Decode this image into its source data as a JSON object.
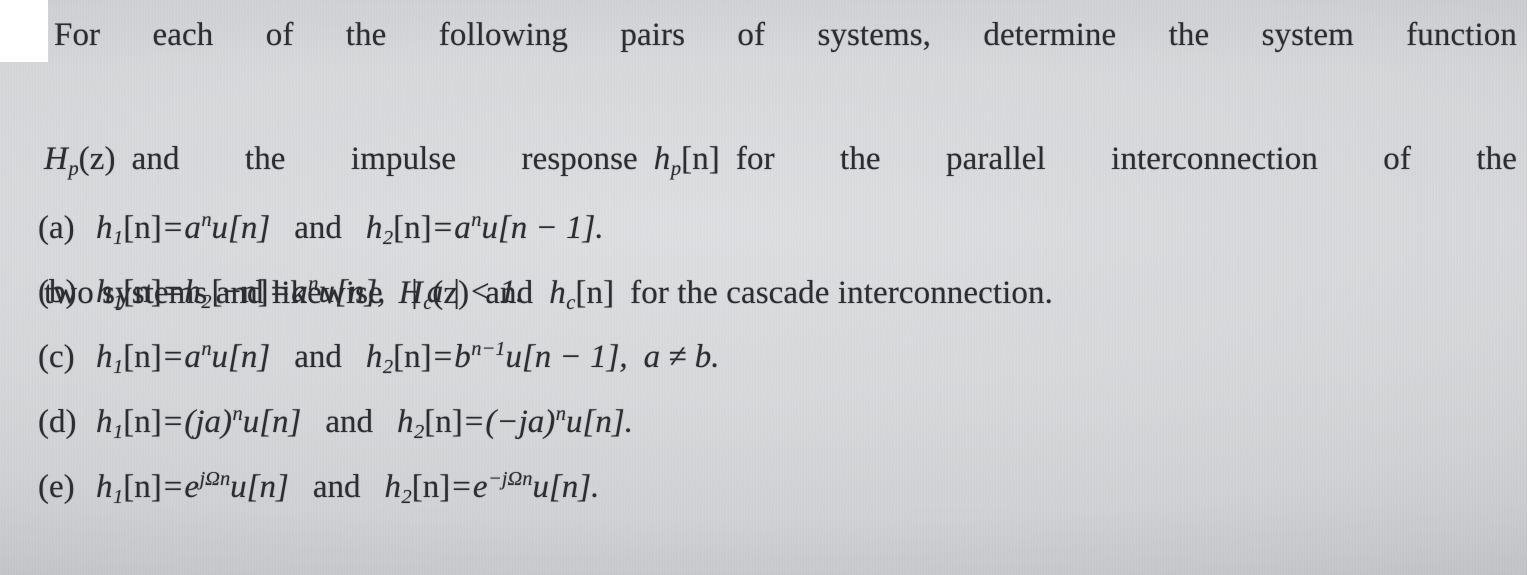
{
  "document": {
    "type": "scanned-textbook-problem",
    "background_color": "#d2d4d7",
    "text_color": "#2b2d31",
    "corner_patch_color": "#ffffff",
    "prompt": {
      "line1": "For each of the following pairs of systems, determine the system function",
      "line2_a": "H",
      "line2_sub": "p",
      "line2_b": "(z)",
      "line2_c": "and the impulse response",
      "line2_d": "h",
      "line2_sub2": "p",
      "line2_e": "[n]",
      "line2_f": "for the parallel interconnection of the",
      "line3_a": "two systems and likewise",
      "line3_b": "H",
      "line3_sub": "c",
      "line3_c": "(z)",
      "line3_and": "and",
      "line3_d": "h",
      "line3_sub2": "c",
      "line3_e": "[n]",
      "line3_f": "for the cascade interconnection."
    },
    "items": [
      {
        "label": "(a)",
        "lhs_fn": "h",
        "lhs_sub": "1",
        "lhs_arg": "[n]",
        "eq": "=",
        "rhs_base": "a",
        "rhs_sup": "n",
        "rhs_u": "u[n]",
        "conj": "and",
        "lhs2_fn": "h",
        "lhs2_sub": "2",
        "lhs2_arg": "[n]",
        "eq2": "=",
        "rhs2_base": "a",
        "rhs2_sup": "n",
        "rhs2_u": "u[n − 1].",
        "plain": "(a)  h₁[n] = aⁿu[n]  and  h₂[n] = aⁿu[n − 1]."
      },
      {
        "label": "(b)",
        "lhs_fn": "h",
        "lhs_sub": "1",
        "lhs_arg": "[n]",
        "eq": "=",
        "mid_fn": "h",
        "mid_sub": "2",
        "mid_arg": "[−n]",
        "eq2": "=",
        "rhs_base": "a",
        "rhs_sup": "n",
        "rhs_u": "u[n],",
        "cond": "| a | < 1.",
        "plain": "(b)  h₁[n] = h₂[−n] = aⁿu[n],  | a | < 1."
      },
      {
        "label": "(c)",
        "lhs_fn": "h",
        "lhs_sub": "1",
        "lhs_arg": "[n]",
        "eq": "=",
        "rhs_base": "a",
        "rhs_sup": "n",
        "rhs_u": "u[n]",
        "conj": "and",
        "lhs2_fn": "h",
        "lhs2_sub": "2",
        "lhs2_arg": "[n]",
        "eq2": "=",
        "rhs2_base": "b",
        "rhs2_sup": "n−1",
        "rhs2_u": "u[n − 1],",
        "cond": "a ≠ b.",
        "plain": "(c)  h₁[n] = aⁿu[n]  and  h₂[n] = bⁿ⁻¹u[n − 1],  a ≠ b."
      },
      {
        "label": "(d)",
        "lhs_fn": "h",
        "lhs_sub": "1",
        "lhs_arg": "[n]",
        "eq": "=",
        "rhs_base": "(ja)",
        "rhs_sup": "n",
        "rhs_u": "u[n]",
        "conj": "and",
        "lhs2_fn": "h",
        "lhs2_sub": "2",
        "lhs2_arg": "[n]",
        "eq2": "=",
        "rhs2_base": "(−ja)",
        "rhs2_sup": "n",
        "rhs2_u": "u[n].",
        "plain": "(d)  h₁[n] = (ja)ⁿu[n]  and  h₂[n] = (−ja)ⁿu[n]."
      },
      {
        "label": "(e)",
        "lhs_fn": "h",
        "lhs_sub": "1",
        "lhs_arg": "[n]",
        "eq": "=",
        "rhs_base": "e",
        "rhs_sup": "jΩn",
        "rhs_u": "u[n]",
        "conj": "and",
        "lhs2_fn": "h",
        "lhs2_sub": "2",
        "lhs2_arg": "[n]",
        "eq2": "=",
        "rhs2_base": "e",
        "rhs2_sup": "−jΩn",
        "rhs2_u": "u[n].",
        "plain": "(e)  h₁[n] = e^{jΩn}u[n]  and  h₂[n] = e^{−jΩn}u[n]."
      }
    ]
  }
}
